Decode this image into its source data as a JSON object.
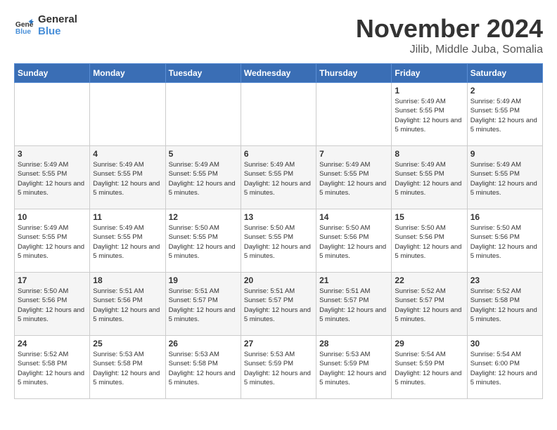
{
  "logo": {
    "line1": "General",
    "line2": "Blue"
  },
  "title": "November 2024",
  "location": "Jilib, Middle Juba, Somalia",
  "weekdays": [
    "Sunday",
    "Monday",
    "Tuesday",
    "Wednesday",
    "Thursday",
    "Friday",
    "Saturday"
  ],
  "weeks": [
    [
      {
        "day": "",
        "info": ""
      },
      {
        "day": "",
        "info": ""
      },
      {
        "day": "",
        "info": ""
      },
      {
        "day": "",
        "info": ""
      },
      {
        "day": "",
        "info": ""
      },
      {
        "day": "1",
        "info": "Sunrise: 5:49 AM\nSunset: 5:55 PM\nDaylight: 12 hours and 5 minutes."
      },
      {
        "day": "2",
        "info": "Sunrise: 5:49 AM\nSunset: 5:55 PM\nDaylight: 12 hours and 5 minutes."
      }
    ],
    [
      {
        "day": "3",
        "info": "Sunrise: 5:49 AM\nSunset: 5:55 PM\nDaylight: 12 hours and 5 minutes."
      },
      {
        "day": "4",
        "info": "Sunrise: 5:49 AM\nSunset: 5:55 PM\nDaylight: 12 hours and 5 minutes."
      },
      {
        "day": "5",
        "info": "Sunrise: 5:49 AM\nSunset: 5:55 PM\nDaylight: 12 hours and 5 minutes."
      },
      {
        "day": "6",
        "info": "Sunrise: 5:49 AM\nSunset: 5:55 PM\nDaylight: 12 hours and 5 minutes."
      },
      {
        "day": "7",
        "info": "Sunrise: 5:49 AM\nSunset: 5:55 PM\nDaylight: 12 hours and 5 minutes."
      },
      {
        "day": "8",
        "info": "Sunrise: 5:49 AM\nSunset: 5:55 PM\nDaylight: 12 hours and 5 minutes."
      },
      {
        "day": "9",
        "info": "Sunrise: 5:49 AM\nSunset: 5:55 PM\nDaylight: 12 hours and 5 minutes."
      }
    ],
    [
      {
        "day": "10",
        "info": "Sunrise: 5:49 AM\nSunset: 5:55 PM\nDaylight: 12 hours and 5 minutes."
      },
      {
        "day": "11",
        "info": "Sunrise: 5:49 AM\nSunset: 5:55 PM\nDaylight: 12 hours and 5 minutes."
      },
      {
        "day": "12",
        "info": "Sunrise: 5:50 AM\nSunset: 5:55 PM\nDaylight: 12 hours and 5 minutes."
      },
      {
        "day": "13",
        "info": "Sunrise: 5:50 AM\nSunset: 5:55 PM\nDaylight: 12 hours and 5 minutes."
      },
      {
        "day": "14",
        "info": "Sunrise: 5:50 AM\nSunset: 5:56 PM\nDaylight: 12 hours and 5 minutes."
      },
      {
        "day": "15",
        "info": "Sunrise: 5:50 AM\nSunset: 5:56 PM\nDaylight: 12 hours and 5 minutes."
      },
      {
        "day": "16",
        "info": "Sunrise: 5:50 AM\nSunset: 5:56 PM\nDaylight: 12 hours and 5 minutes."
      }
    ],
    [
      {
        "day": "17",
        "info": "Sunrise: 5:50 AM\nSunset: 5:56 PM\nDaylight: 12 hours and 5 minutes."
      },
      {
        "day": "18",
        "info": "Sunrise: 5:51 AM\nSunset: 5:56 PM\nDaylight: 12 hours and 5 minutes."
      },
      {
        "day": "19",
        "info": "Sunrise: 5:51 AM\nSunset: 5:57 PM\nDaylight: 12 hours and 5 minutes."
      },
      {
        "day": "20",
        "info": "Sunrise: 5:51 AM\nSunset: 5:57 PM\nDaylight: 12 hours and 5 minutes."
      },
      {
        "day": "21",
        "info": "Sunrise: 5:51 AM\nSunset: 5:57 PM\nDaylight: 12 hours and 5 minutes."
      },
      {
        "day": "22",
        "info": "Sunrise: 5:52 AM\nSunset: 5:57 PM\nDaylight: 12 hours and 5 minutes."
      },
      {
        "day": "23",
        "info": "Sunrise: 5:52 AM\nSunset: 5:58 PM\nDaylight: 12 hours and 5 minutes."
      }
    ],
    [
      {
        "day": "24",
        "info": "Sunrise: 5:52 AM\nSunset: 5:58 PM\nDaylight: 12 hours and 5 minutes."
      },
      {
        "day": "25",
        "info": "Sunrise: 5:53 AM\nSunset: 5:58 PM\nDaylight: 12 hours and 5 minutes."
      },
      {
        "day": "26",
        "info": "Sunrise: 5:53 AM\nSunset: 5:58 PM\nDaylight: 12 hours and 5 minutes."
      },
      {
        "day": "27",
        "info": "Sunrise: 5:53 AM\nSunset: 5:59 PM\nDaylight: 12 hours and 5 minutes."
      },
      {
        "day": "28",
        "info": "Sunrise: 5:53 AM\nSunset: 5:59 PM\nDaylight: 12 hours and 5 minutes."
      },
      {
        "day": "29",
        "info": "Sunrise: 5:54 AM\nSunset: 5:59 PM\nDaylight: 12 hours and 5 minutes."
      },
      {
        "day": "30",
        "info": "Sunrise: 5:54 AM\nSunset: 6:00 PM\nDaylight: 12 hours and 5 minutes."
      }
    ]
  ]
}
